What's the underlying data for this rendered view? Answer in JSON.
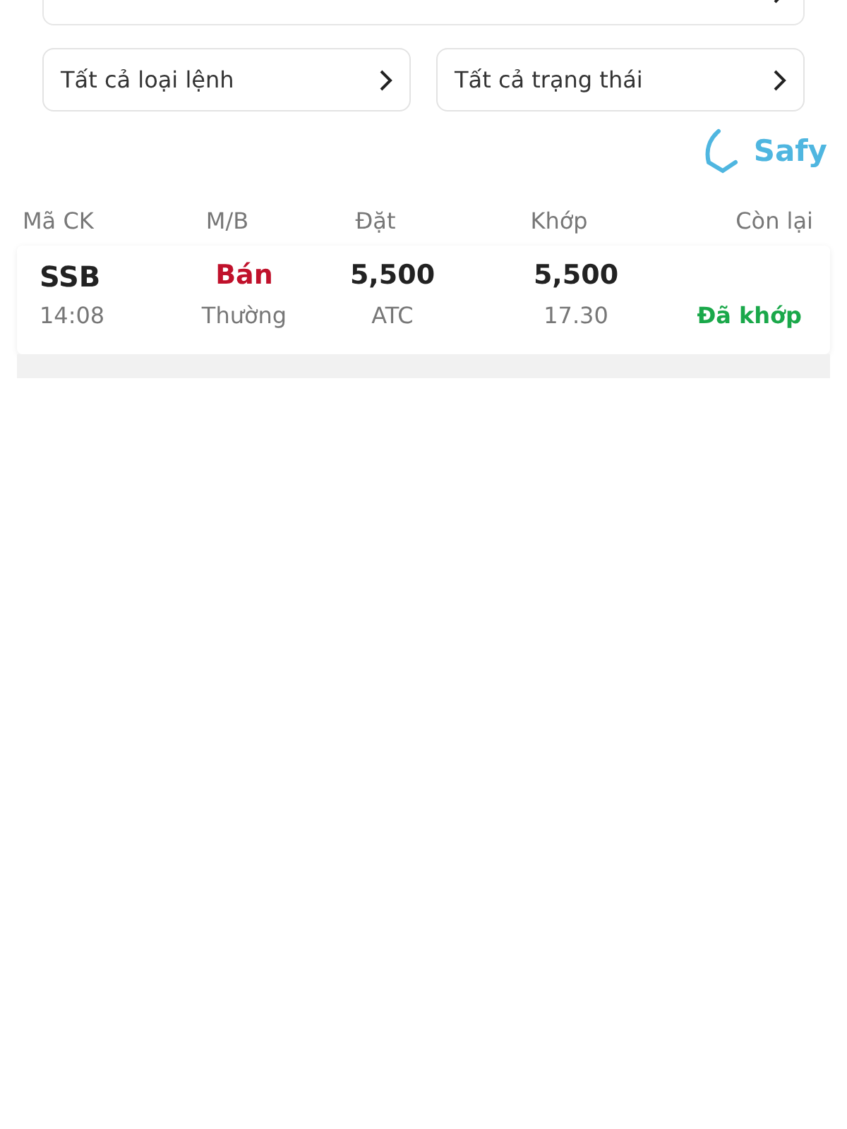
{
  "filters": [
    {
      "label": "Tất cả loại lệnh"
    },
    {
      "label": "Tất cả trạng thái"
    }
  ],
  "brand": {
    "name": "Safy"
  },
  "table": {
    "columns": [
      "Mã CK",
      "M/B",
      "Đặt",
      "Khớp",
      "Còn lại"
    ],
    "rows": [
      {
        "symbol": "SSB",
        "time": "14:08",
        "side": {
          "text": "Bán",
          "kind": "sell"
        },
        "order_type": "Thường",
        "price": "5,500",
        "session": "ATC",
        "matched_price": "5,500",
        "matched_time": "17.30",
        "status": {
          "text": "Đã khớp",
          "kind": "matched"
        }
      }
    ]
  }
}
